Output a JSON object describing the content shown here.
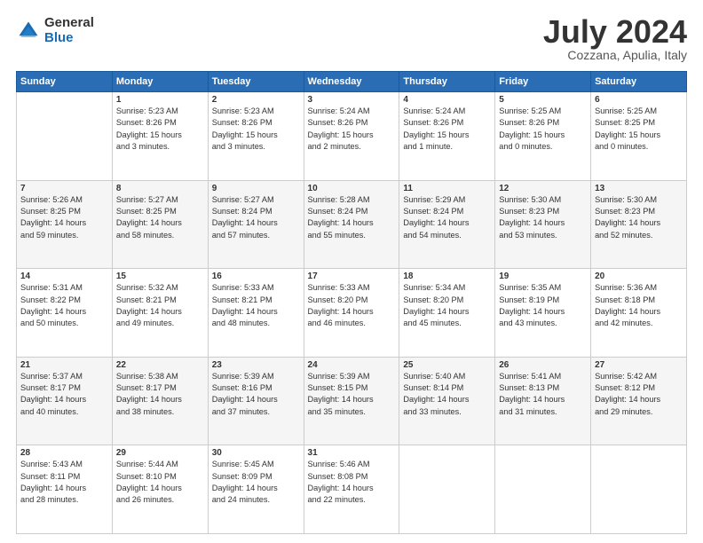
{
  "logo": {
    "general": "General",
    "blue": "Blue"
  },
  "title": "July 2024",
  "subtitle": "Cozzana, Apulia, Italy",
  "headers": [
    "Sunday",
    "Monday",
    "Tuesday",
    "Wednesday",
    "Thursday",
    "Friday",
    "Saturday"
  ],
  "weeks": [
    [
      {
        "day": "",
        "info": ""
      },
      {
        "day": "1",
        "info": "Sunrise: 5:23 AM\nSunset: 8:26 PM\nDaylight: 15 hours\nand 3 minutes."
      },
      {
        "day": "2",
        "info": "Sunrise: 5:23 AM\nSunset: 8:26 PM\nDaylight: 15 hours\nand 3 minutes."
      },
      {
        "day": "3",
        "info": "Sunrise: 5:24 AM\nSunset: 8:26 PM\nDaylight: 15 hours\nand 2 minutes."
      },
      {
        "day": "4",
        "info": "Sunrise: 5:24 AM\nSunset: 8:26 PM\nDaylight: 15 hours\nand 1 minute."
      },
      {
        "day": "5",
        "info": "Sunrise: 5:25 AM\nSunset: 8:26 PM\nDaylight: 15 hours\nand 0 minutes."
      },
      {
        "day": "6",
        "info": "Sunrise: 5:25 AM\nSunset: 8:25 PM\nDaylight: 15 hours\nand 0 minutes."
      }
    ],
    [
      {
        "day": "7",
        "info": "Sunrise: 5:26 AM\nSunset: 8:25 PM\nDaylight: 14 hours\nand 59 minutes."
      },
      {
        "day": "8",
        "info": "Sunrise: 5:27 AM\nSunset: 8:25 PM\nDaylight: 14 hours\nand 58 minutes."
      },
      {
        "day": "9",
        "info": "Sunrise: 5:27 AM\nSunset: 8:24 PM\nDaylight: 14 hours\nand 57 minutes."
      },
      {
        "day": "10",
        "info": "Sunrise: 5:28 AM\nSunset: 8:24 PM\nDaylight: 14 hours\nand 55 minutes."
      },
      {
        "day": "11",
        "info": "Sunrise: 5:29 AM\nSunset: 8:24 PM\nDaylight: 14 hours\nand 54 minutes."
      },
      {
        "day": "12",
        "info": "Sunrise: 5:30 AM\nSunset: 8:23 PM\nDaylight: 14 hours\nand 53 minutes."
      },
      {
        "day": "13",
        "info": "Sunrise: 5:30 AM\nSunset: 8:23 PM\nDaylight: 14 hours\nand 52 minutes."
      }
    ],
    [
      {
        "day": "14",
        "info": "Sunrise: 5:31 AM\nSunset: 8:22 PM\nDaylight: 14 hours\nand 50 minutes."
      },
      {
        "day": "15",
        "info": "Sunrise: 5:32 AM\nSunset: 8:21 PM\nDaylight: 14 hours\nand 49 minutes."
      },
      {
        "day": "16",
        "info": "Sunrise: 5:33 AM\nSunset: 8:21 PM\nDaylight: 14 hours\nand 48 minutes."
      },
      {
        "day": "17",
        "info": "Sunrise: 5:33 AM\nSunset: 8:20 PM\nDaylight: 14 hours\nand 46 minutes."
      },
      {
        "day": "18",
        "info": "Sunrise: 5:34 AM\nSunset: 8:20 PM\nDaylight: 14 hours\nand 45 minutes."
      },
      {
        "day": "19",
        "info": "Sunrise: 5:35 AM\nSunset: 8:19 PM\nDaylight: 14 hours\nand 43 minutes."
      },
      {
        "day": "20",
        "info": "Sunrise: 5:36 AM\nSunset: 8:18 PM\nDaylight: 14 hours\nand 42 minutes."
      }
    ],
    [
      {
        "day": "21",
        "info": "Sunrise: 5:37 AM\nSunset: 8:17 PM\nDaylight: 14 hours\nand 40 minutes."
      },
      {
        "day": "22",
        "info": "Sunrise: 5:38 AM\nSunset: 8:17 PM\nDaylight: 14 hours\nand 38 minutes."
      },
      {
        "day": "23",
        "info": "Sunrise: 5:39 AM\nSunset: 8:16 PM\nDaylight: 14 hours\nand 37 minutes."
      },
      {
        "day": "24",
        "info": "Sunrise: 5:39 AM\nSunset: 8:15 PM\nDaylight: 14 hours\nand 35 minutes."
      },
      {
        "day": "25",
        "info": "Sunrise: 5:40 AM\nSunset: 8:14 PM\nDaylight: 14 hours\nand 33 minutes."
      },
      {
        "day": "26",
        "info": "Sunrise: 5:41 AM\nSunset: 8:13 PM\nDaylight: 14 hours\nand 31 minutes."
      },
      {
        "day": "27",
        "info": "Sunrise: 5:42 AM\nSunset: 8:12 PM\nDaylight: 14 hours\nand 29 minutes."
      }
    ],
    [
      {
        "day": "28",
        "info": "Sunrise: 5:43 AM\nSunset: 8:11 PM\nDaylight: 14 hours\nand 28 minutes."
      },
      {
        "day": "29",
        "info": "Sunrise: 5:44 AM\nSunset: 8:10 PM\nDaylight: 14 hours\nand 26 minutes."
      },
      {
        "day": "30",
        "info": "Sunrise: 5:45 AM\nSunset: 8:09 PM\nDaylight: 14 hours\nand 24 minutes."
      },
      {
        "day": "31",
        "info": "Sunrise: 5:46 AM\nSunset: 8:08 PM\nDaylight: 14 hours\nand 22 minutes."
      },
      {
        "day": "",
        "info": ""
      },
      {
        "day": "",
        "info": ""
      },
      {
        "day": "",
        "info": ""
      }
    ]
  ]
}
